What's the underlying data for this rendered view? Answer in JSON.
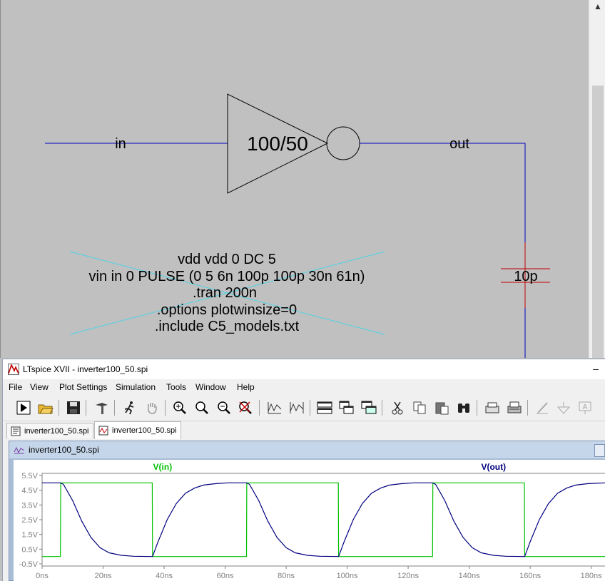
{
  "schematic": {
    "net_in_label": "in",
    "net_out_label": "out",
    "inverter_label": "100/50",
    "capacitor_label": "10p",
    "spice_directives": [
      "vdd vdd 0 DC 5",
      "vin in 0 PULSE (0 5 6n 100p 100p 30n 61n)",
      ".tran 200n",
      ".options plotwinsize=0",
      ".include C5_models.txt"
    ]
  },
  "window": {
    "title": "LTspice XVII - inverter100_50.spi",
    "minimize_glyph": "–"
  },
  "menu": [
    "File",
    "View",
    "Plot Settings",
    "Simulation",
    "Tools",
    "Window",
    "Help"
  ],
  "toolbar_icons": [
    "run-icon",
    "open-icon",
    "save-icon",
    "control-panel-icon",
    "halt-icon",
    "pan-icon",
    "zoom-in-icon",
    "zoom-area-icon",
    "zoom-out-icon",
    "zoom-cancel-icon",
    "autorange-icon",
    "fit-icon",
    "tile-horizontal-icon",
    "cascade-icon",
    "tile-vertical-icon",
    "cut-icon",
    "copy-icon",
    "paste-icon",
    "find-icon",
    "print-preview-icon",
    "print-icon",
    "wire-icon",
    "ground-icon",
    "label-net-icon"
  ],
  "tabs": [
    {
      "label": "inverter100_50.spi",
      "kind": "schematic"
    },
    {
      "label": "inverter100_50.spi",
      "kind": "waveform"
    }
  ],
  "plot_window": {
    "title": "inverter100_50.spi"
  },
  "chart_data": {
    "type": "line",
    "series": [
      {
        "name": "V(in)",
        "color": "#00c000",
        "x": [
          0,
          6,
          6.1,
          36.1,
          36.2,
          67,
          67.1,
          97.1,
          97.2,
          128,
          128.1,
          158.1,
          158.2,
          185
        ],
        "y": [
          0,
          0,
          5,
          5,
          0,
          0,
          5,
          5,
          0,
          0,
          5,
          5,
          0,
          0
        ]
      },
      {
        "name": "V(out)",
        "color": "#00007f",
        "x": [
          0,
          6,
          7,
          10,
          13,
          16,
          19,
          22,
          26,
          30,
          36,
          36.2,
          38,
          41,
          44,
          47,
          50,
          53,
          57,
          61,
          67,
          68,
          71,
          74,
          77,
          80,
          83,
          87,
          91,
          97.2,
          99,
          102,
          105,
          108,
          111,
          114,
          118,
          122,
          128,
          129,
          132,
          135,
          138,
          141,
          144,
          148,
          152,
          158.2,
          160,
          163,
          166,
          169,
          172,
          175,
          179,
          185
        ],
        "y": [
          5,
          5,
          4.9,
          3.8,
          2.4,
          1.3,
          0.6,
          0.25,
          0.08,
          0.02,
          0,
          0,
          1.0,
          2.5,
          3.6,
          4.3,
          4.65,
          4.85,
          4.95,
          5,
          5,
          4.9,
          3.8,
          2.4,
          1.3,
          0.6,
          0.25,
          0.08,
          0.02,
          0,
          1.0,
          2.5,
          3.6,
          4.3,
          4.65,
          4.85,
          4.95,
          5,
          5,
          4.9,
          3.8,
          2.4,
          1.3,
          0.6,
          0.25,
          0.08,
          0.02,
          0,
          1.0,
          2.5,
          3.6,
          4.3,
          4.65,
          4.85,
          4.95,
          5
        ]
      }
    ],
    "x_ticks": [
      "0ns",
      "20ns",
      "40ns",
      "60ns",
      "80ns",
      "100ns",
      "120ns",
      "140ns",
      "160ns",
      "180ns"
    ],
    "x_tick_values": [
      0,
      20,
      40,
      60,
      80,
      100,
      120,
      140,
      160,
      180
    ],
    "y_ticks": [
      "5.5V",
      "4.5V",
      "3.5V",
      "2.5V",
      "1.5V",
      "0.5V",
      "-0.5V"
    ],
    "y_tick_values": [
      5.5,
      4.5,
      3.5,
      2.5,
      1.5,
      0.5,
      -0.5
    ],
    "xlim": [
      0,
      185
    ],
    "ylim": [
      -0.5,
      5.5
    ],
    "grid": false,
    "legend_placement": "top"
  }
}
